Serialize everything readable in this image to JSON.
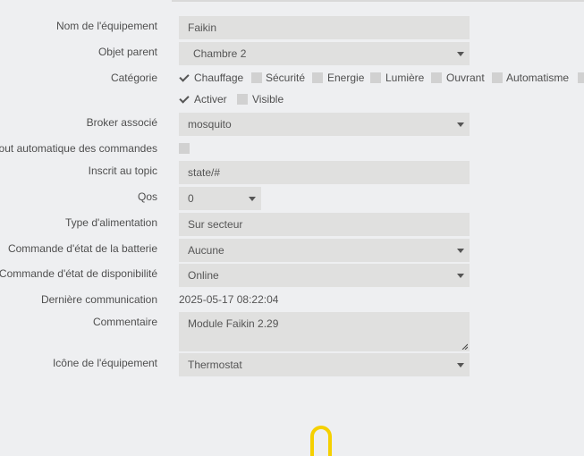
{
  "form": {
    "name_label": "Nom de l'équipement",
    "name_value": "Faikin",
    "parent_label": "Objet parent",
    "parent_value": "Chambre 2",
    "category_label": "Catégorie",
    "categories": [
      {
        "label": "Chauffage",
        "checked": true
      },
      {
        "label": "Sécurité",
        "checked": false
      },
      {
        "label": "Energie",
        "checked": false
      },
      {
        "label": "Lumière",
        "checked": false
      },
      {
        "label": "Ouvrant",
        "checked": false
      },
      {
        "label": "Automatisme",
        "checked": false
      }
    ],
    "activate_label": "Activer",
    "activate_checked": true,
    "visible_label": "Visible",
    "visible_checked": false,
    "broker_label": "Broker associé",
    "broker_value": "mosquito",
    "auto_add_label": "Ajout automatique des commandes",
    "auto_add_checked": false,
    "topic_label": "Inscrit au topic",
    "topic_value": "state/#",
    "qos_label": "Qos",
    "qos_value": "0",
    "power_label": "Type d'alimentation",
    "power_value": "Sur secteur",
    "battery_cmd_label": "Commande d'état de la batterie",
    "battery_cmd_value": "Aucune",
    "availability_cmd_label": "Commande d'état de disponibilité",
    "availability_cmd_value": "Online",
    "last_comm_label": "Dernière communication",
    "last_comm_value": "2025-05-17 08:22:04",
    "comment_label": "Commentaire",
    "comment_value": "Module Faikin 2.29",
    "icon_label": "Icône de l'équipement",
    "icon_value": "Thermostat"
  },
  "colors": {
    "background": "#eeeff1",
    "field_bg": "#e0e0df",
    "checkbox_bg": "#d1d1d1",
    "loader": "#f5d000"
  }
}
